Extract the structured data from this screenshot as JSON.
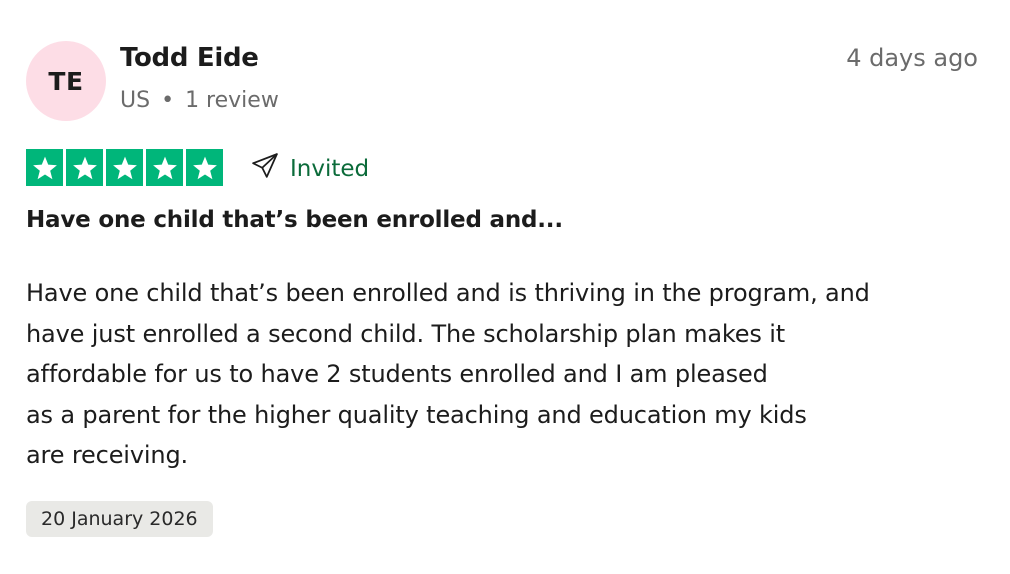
{
  "reviewer": {
    "initials": "TE",
    "name": "Todd Eide",
    "country": "US",
    "separator": "•",
    "review_count": "1 review",
    "avatar_color": "#fddde6"
  },
  "review": {
    "time_ago": "4 days ago",
    "rating": 5,
    "rating_max": 5,
    "star_color": "#00b67a",
    "star_icon": "star-icon",
    "invited_icon": "paper-plane-icon",
    "invited_label": "Invited",
    "title": "Have one child that’s been enrolled and...",
    "body_lines": [
      "Have one child that’s been enrolled and is thriving in the program, and",
      "have just enrolled a second child. The scholarship plan makes it",
      "affordable for us to have 2 students enrolled and I am pleased",
      "as a parent for the higher quality teaching and education my kids",
      "are receiving."
    ],
    "date": "20 January 2026"
  }
}
